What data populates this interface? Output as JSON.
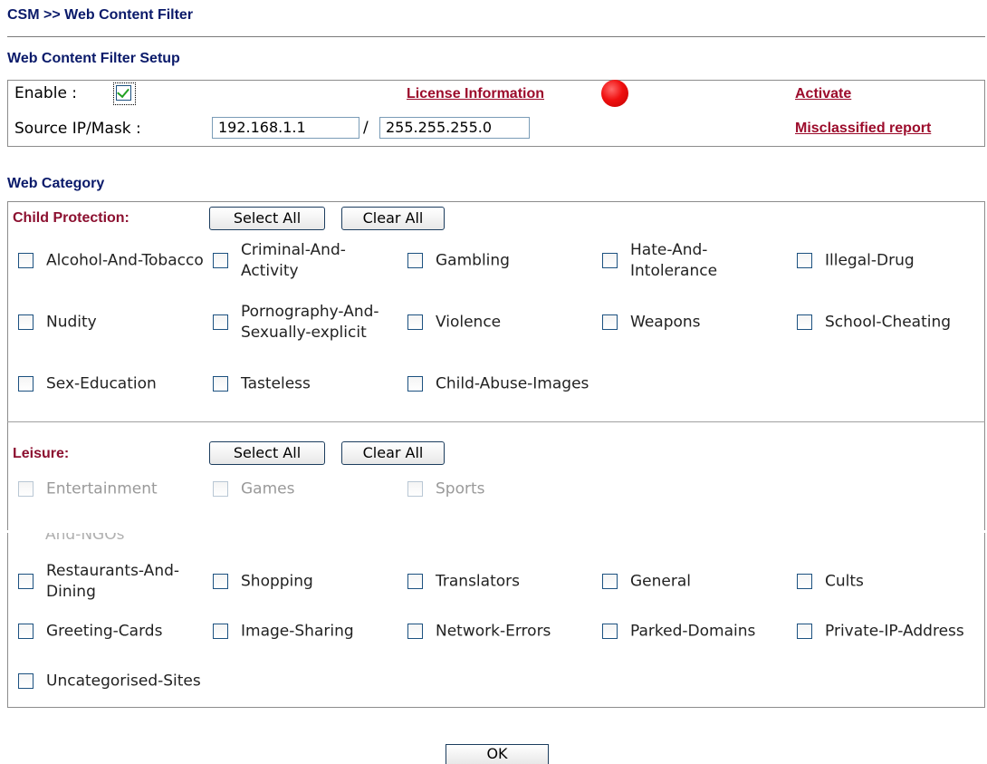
{
  "header": {
    "title": "CSM >> Web Content Filter"
  },
  "setup": {
    "title": "Web Content Filter Setup",
    "enable_label": "Enable :",
    "enable_checked": true,
    "source_label": "Source IP/Mask :",
    "source_ip": "192.168.1.1",
    "separator": "/",
    "mask": "255.255.255.0",
    "license_link": "License Information",
    "license_status_color": "#e01010",
    "activate_link": "Activate",
    "misclassified_link": "Misclassified report"
  },
  "web_category": {
    "title": "Web Category",
    "child_protection": {
      "label": "Child Protection:",
      "select_all": "Select All",
      "clear_all": "Clear All",
      "items": [
        "Alcohol-And-Tobacco",
        "Criminal-And-Activity",
        "Gambling",
        "Hate-And-Intolerance",
        "Illegal-Drug",
        "Nudity",
        "Pornography-And-Sexually-explicit",
        "Violence",
        "Weapons",
        "School-Cheating",
        "Sex-Education",
        "Tasteless",
        "Child-Abuse-Images"
      ]
    },
    "leisure": {
      "label": "Leisure:",
      "select_all": "Select All",
      "clear_all": "Clear All",
      "items": [
        "Entertainment",
        "Games",
        "Sports"
      ]
    },
    "partial_text": "And-NGOs",
    "others": {
      "items": [
        "Restaurants-And-Dining",
        "Shopping",
        "Translators",
        "General",
        "Cults",
        "Greeting-Cards",
        "Image-Sharing",
        "Network-Errors",
        "Parked-Domains",
        "Private-IP-Address",
        "Uncategorised-Sites"
      ]
    }
  },
  "ok_button": "OK"
}
